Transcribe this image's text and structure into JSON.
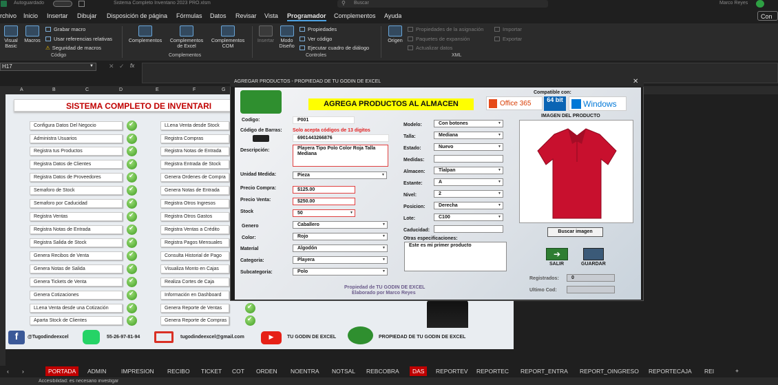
{
  "app": {
    "autosave_label": "Autoguardado",
    "file_title": "Sistema Completo Inventario 2023 PRO.xlsm",
    "search_placeholder": "Buscar",
    "user_name": "Marco Reyes",
    "share_label": "Con"
  },
  "ribbon_tabs": [
    "rchivo",
    "Inicio",
    "Insertar",
    "Dibujar",
    "Disposición de página",
    "Fórmulas",
    "Datos",
    "Revisar",
    "Vista",
    "Programador",
    "Complementos",
    "Ayuda"
  ],
  "ribbon": {
    "codigo": {
      "visual_basic": "Visual Basic",
      "macros": "Macros",
      "grabar": "Grabar macro",
      "referencias": "Usar referencias relativas",
      "seguridad": "Seguridad de macros",
      "label": "Código"
    },
    "complementos": {
      "complementos": "Complementos",
      "excel": "Complementos de Excel",
      "com": "Complementos COM",
      "label": "Complementos"
    },
    "controles": {
      "insertar": "Insertar",
      "modo": "Modo Diseño",
      "propiedades": "Propiedades",
      "ver_codigo": "Ver código",
      "ejecutar": "Ejecutar cuadro de diálogo",
      "label": "Controles"
    },
    "xml": {
      "origen": "Origen",
      "propiedades": "Propiedades de la asignación",
      "paquetes": "Paquetes de expansión",
      "actualizar": "Actualizar datos",
      "importar": "Importar",
      "exportar": "Exportar",
      "label": "XML"
    }
  },
  "formula_bar": {
    "name_box": "H17",
    "fx": "fx"
  },
  "columns": [
    "A",
    "B",
    "C",
    "D",
    "E",
    "F",
    "G"
  ],
  "sheet": {
    "banner": "SISTEMA COMPLETO DE INVENTARI",
    "menu_col1": [
      "Configura Datos Del Negocio",
      "Administra Usuarios",
      "Registra tus Productos",
      "Registra Datos de Clientes",
      "Registra Datos de Proveedores",
      "Semaforo de Stock",
      "Semaforo por Caducidad",
      "Registra Ventas",
      "Registra Notas de  Entrada",
      "Registra Salida de Stock",
      "Genera Recibos de Venta",
      "Genera Notas de Salida",
      "Genera Tickets de Venta",
      "Genera Cotizaciones",
      "LLena Venta desde una Cotización",
      "Aparta Stock de Clientes"
    ],
    "menu_col2": [
      "LLena Venta desde Stock",
      "Registra Compras",
      "Registra Notas de Entrada",
      "Registra Entrada de Stock",
      "Genera Ordenes de Compra",
      "Genera Notas de Entrada",
      "Registra Otros Ingresos",
      "Registra Otros Gastos",
      "Registra Ventas a Crédito",
      "Registra Pagos Mensuales",
      "Consulta Historial de Pago",
      "Visualiza Monto en Cajas",
      "Realiza Cortes de Caja",
      "Información en Dashboard",
      "Genera Reporte de Ventas",
      "Genera Reporte de Compras"
    ],
    "footer": {
      "facebook": "@Tugodindeexcel",
      "whatsapp": "55-26-97-81-94",
      "email": "tugodindeexcel@gmail.com",
      "youtube": "TU GODIN DE EXCEL",
      "owner": "PROPIEDAD DE TU GODIN DE EXCEL"
    }
  },
  "dialog": {
    "title": "AGREGAR PRODUCTOS - PROPIEDAD DE TU GODIN DE EXCEL",
    "headline": "AGREGA PRODUCTOS AL ALMACEN",
    "compatible": "Compatible con:",
    "office": "Office 365",
    "bits": "64 bit",
    "windows": "Windows",
    "image_label": "IMAGEN DEL PRODUCTO",
    "labels": {
      "codigo": "Codigo:",
      "barras": "Código de Barras:",
      "descripcion": "Descripción:",
      "unidad": "Unidad Medida:",
      "precio_compra": "Precio Compra:",
      "precio_venta": "Precio Venta:",
      "stock": "Stock",
      "genero": "Genero",
      "color": "Color:",
      "material": "Material",
      "categoria": "Categoria:",
      "subcategoria": "Subcategoria:",
      "modelo": "Modelo:",
      "talla": "Talla:",
      "estado": "Estado:",
      "medidas": "Medidas:",
      "almacen": "Almacen:",
      "estante": "Estante:",
      "nivel": "Nivel:",
      "posicion": "Posicion:",
      "lote": "Lote:",
      "caducidad": "Caducidad:",
      "otras": "Otras especificaciones:",
      "registrados": "Registrados:",
      "ultimo": "Ultimo Cod:"
    },
    "values": {
      "codigo": "P001",
      "barras_note": "Solo acepta códigos de 13 digitos",
      "barras": "6901443266876",
      "descripcion": "Playera Tipo Polo Color Roja Talla Mediana",
      "unidad": "Pieza",
      "precio_compra": "$125.00",
      "precio_venta": "$250.00",
      "stock": "50",
      "genero": "Caballero",
      "color": "Rojo",
      "material": "Algodón",
      "categoria": "Playera",
      "subcategoria": "Polo",
      "modelo": "Con botones",
      "talla": "Mediana",
      "estado": "Nuevo",
      "medidas": "",
      "almacen": "Tlalpan",
      "estante": "A",
      "nivel": "2",
      "posicion": "Derecha",
      "lote": "C100",
      "caducidad": "",
      "otras": "Este es mi primer producto",
      "registrados": "0",
      "ultimo": ""
    },
    "buttons": {
      "buscar": "Buscar imagen",
      "salir": "SALIR",
      "guardar": "GUARDAR"
    },
    "credits": [
      "Propiedad de TU GODIN DE EXCEL",
      "Elaborado por Marco Reyes"
    ]
  },
  "sheet_tabs": [
    "PORTADA",
    "ADMIN",
    "IMPRESION",
    "RECIBO",
    "TICKET",
    "COT",
    "ORDEN",
    "NOENTRA",
    "NOTSAL",
    "REBCOBRA",
    "DAS",
    "REPORTEV",
    "REPORTEC",
    "REPORT_ENTRA",
    "REPORT_OINGRESO",
    "REPORTECAJA",
    "REI"
  ],
  "status": {
    "accessibility": "Accesibilidad: es necesario investigar"
  },
  "colors": {
    "accent": "#217346",
    "shirt": "#c8102e",
    "banner_text": "#c00000",
    "headline_bg": "#ffff00"
  }
}
